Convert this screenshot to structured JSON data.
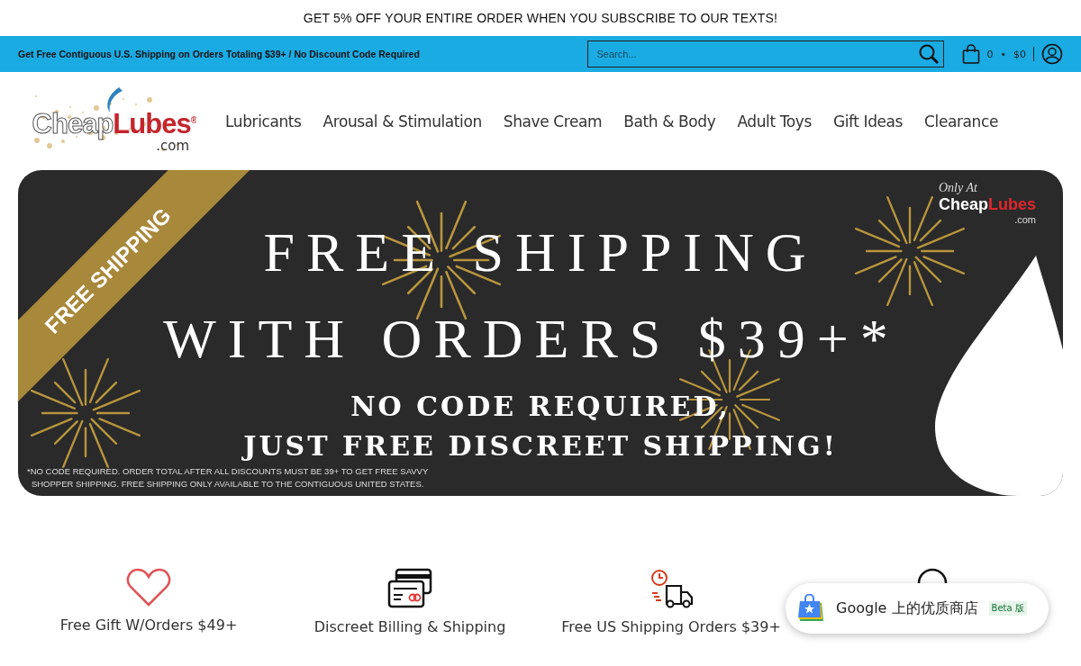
{
  "announcement": "GET 5% OFF YOUR ENTIRE ORDER WHEN YOU SUBSCRIBE TO OUR TEXTS!",
  "utility_bar": {
    "message": "Get Free Contiguous U.S. Shipping on Orders Totaling $39+ / No Discount Code Required",
    "search": {
      "placeholder": "Search..."
    },
    "cart": {
      "count": "0",
      "separator": "•",
      "total": "$0"
    }
  },
  "logo": {
    "first": "Cheap",
    "second": "Lubes",
    "mark": "®",
    "suffix": ".com"
  },
  "nav": [
    {
      "label": "Lubricants"
    },
    {
      "label": "Arousal & Stimulation"
    },
    {
      "label": "Shave Cream"
    },
    {
      "label": "Bath & Body"
    },
    {
      "label": "Adult Toys"
    },
    {
      "label": "Gift Ideas"
    },
    {
      "label": "Clearance"
    }
  ],
  "banner": {
    "ribbon": "FREE SHIPPING",
    "headline_1": "FREE SHIPPING",
    "headline_2": "WITH ORDERS $39+*",
    "subline_1": "NO CODE REQUIRED,",
    "subline_2": "JUST FREE DISCREET SHIPPING!",
    "fine_print_1": "*NO CODE REQUIRED. ORDER TOTAL AFTER ALL DISCOUNTS MUST BE 39+ TO GET FREE SAVVY",
    "fine_print_2": "SHOPPER SHIPPING. FREE SHIPPING ONLY AVAILABLE TO THE CONTIGUOUS UNITED STATES.",
    "badge_script": "Only At",
    "badge_first": "Cheap",
    "badge_second": "Lubes",
    "badge_suffix": ".com"
  },
  "features": [
    {
      "kind": "heart",
      "label": "Free Gift W/Orders $49+"
    },
    {
      "kind": "cards",
      "label": "Discreet Billing & Shipping"
    },
    {
      "kind": "truck",
      "label": "Free US Shipping Orders $39+"
    },
    {
      "kind": "support"
    }
  ],
  "popup": {
    "title": "Google 上的优质商店",
    "badge": "Beta 版"
  }
}
